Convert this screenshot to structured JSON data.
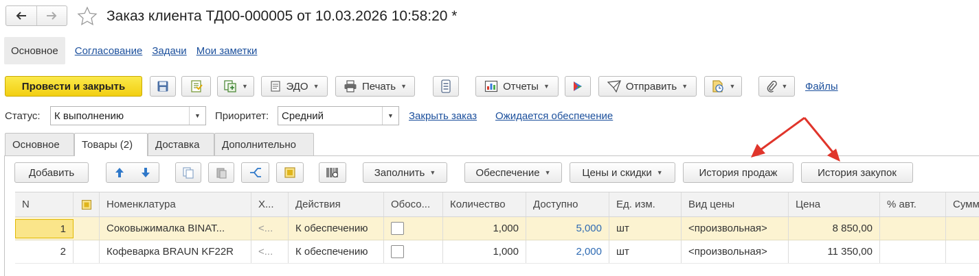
{
  "window": {
    "title": "Заказ клиента ТД00-000005 от 10.03.2026 10:58:20 *"
  },
  "section_nav": {
    "items": [
      "Основное",
      "Согласование",
      "Задачи",
      "Мои заметки"
    ],
    "active": "Основное"
  },
  "toolbar": {
    "post_close": "Провести и закрыть",
    "edo": "ЭДО",
    "print": "Печать",
    "reports": "Отчеты",
    "send": "Отправить",
    "files": "Файлы"
  },
  "status": {
    "status_label": "Статус:",
    "status_value": "К выполнению",
    "priority_label": "Приоритет:",
    "priority_value": "Средний",
    "close_order": "Закрыть заказ",
    "awaiting": "Ожидается обеспечение"
  },
  "tabs": [
    "Основное",
    "Товары (2)",
    "Доставка",
    "Дополнительно"
  ],
  "active_tab": "Товары (2)",
  "goods_toolbar": {
    "add": "Добавить",
    "fill": "Заполнить",
    "provision": "Обеспечение",
    "prices": "Цены и скидки",
    "sales_history": "История продаж",
    "purchase_history": "История закупок"
  },
  "table": {
    "columns": [
      "N",
      "",
      "Номенклатура",
      "Х...",
      "Действия",
      "Обосо...",
      "Количество",
      "Доступно",
      "Ед. изм.",
      "Вид цены",
      "Цена",
      "% авт.",
      "Сумм"
    ],
    "rows": [
      {
        "n": "1",
        "item": "Соковыжималка  BINAT...",
        "char": "<...",
        "action": "К обеспечению",
        "separate": false,
        "qty": "1,000",
        "available": "5,000",
        "unit": "шт",
        "price_type": "<произвольная>",
        "price": "8 850,00",
        "auto_pct": "",
        "sum": ""
      },
      {
        "n": "2",
        "item": "Кофеварка BRAUN KF22R",
        "char": "<...",
        "action": "К обеспечению",
        "separate": false,
        "qty": "1,000",
        "available": "2,000",
        "unit": "шт",
        "price_type": "<произвольная>",
        "price": "11 350,00",
        "auto_pct": "",
        "sum": ""
      }
    ]
  },
  "colors": {
    "primary_button": "#f2cf12",
    "link": "#1b4f9c",
    "selected_row": "#fcf3d1",
    "annotation_arrow": "#e0352b"
  }
}
